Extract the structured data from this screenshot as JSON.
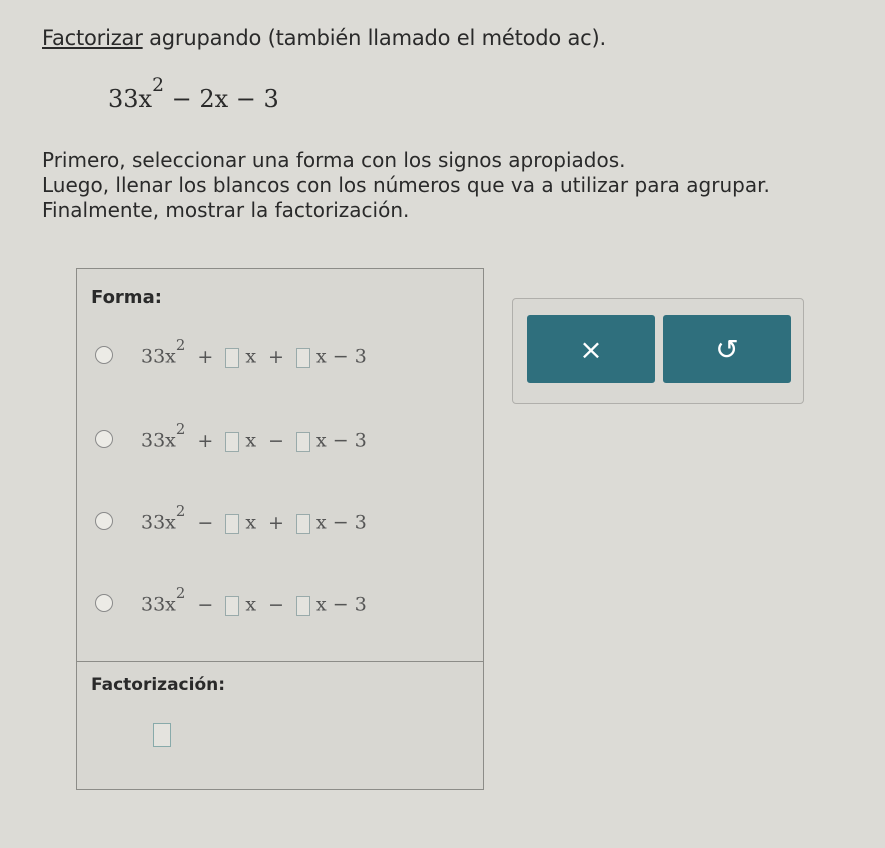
{
  "prompt": {
    "link": "Factorizar",
    "rest": " agrupando (también llamado el método ac)."
  },
  "expression": {
    "coef": "33x",
    "exp": "2",
    "rest": " − 2x − 3"
  },
  "instructions": [
    "Primero, seleccionar una forma con los signos apropiados.",
    "Luego, llenar los blancos con los números que va a utilizar para agrupar.",
    "Finalmente, mostrar la factorización."
  ],
  "forma_label": "Forma:",
  "options": [
    {
      "lead": "33x",
      "exp": "2",
      "op1": "+",
      "op2": "+",
      "tail": "x − 3"
    },
    {
      "lead": "33x",
      "exp": "2",
      "op1": "+",
      "op2": "−",
      "tail": "x − 3"
    },
    {
      "lead": "33x",
      "exp": "2",
      "op1": "−",
      "op2": "+",
      "tail": "x − 3"
    },
    {
      "lead": "33x",
      "exp": "2",
      "op1": "−",
      "op2": "−",
      "tail": "x − 3"
    }
  ],
  "x_symbol": "x",
  "factorization_label": "Factorización:",
  "buttons": {
    "clear": "×",
    "undo": "↺"
  }
}
